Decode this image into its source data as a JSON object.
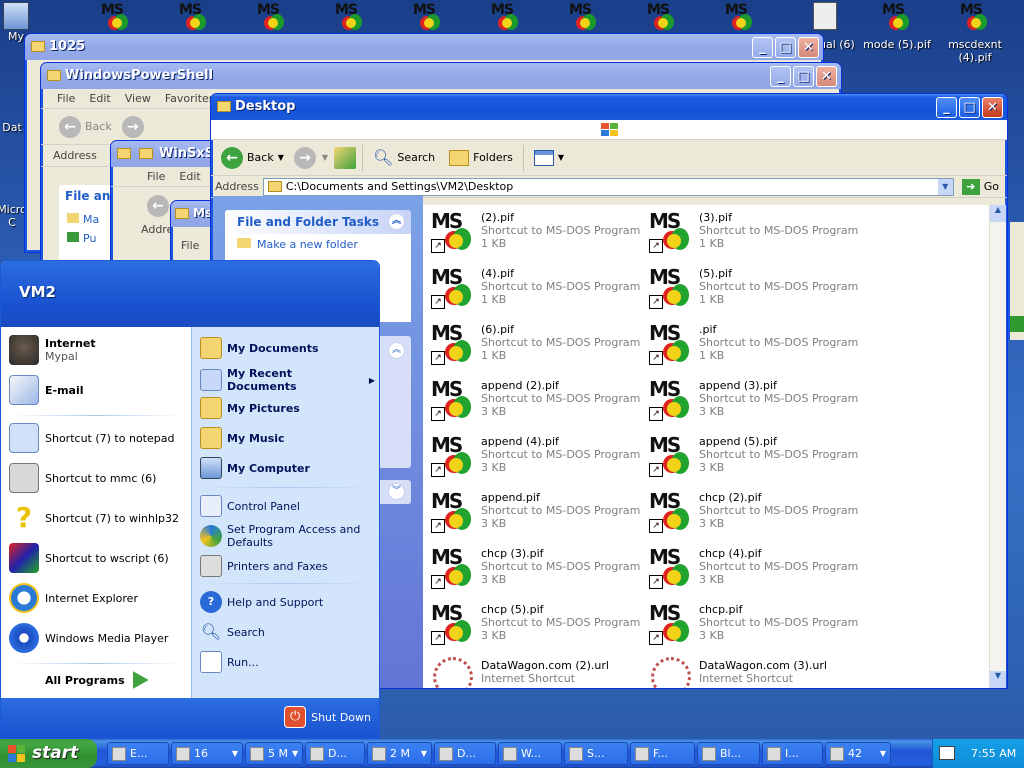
{
  "desktop": {
    "icons": [
      {
        "label": "My"
      },
      {
        "label": "Dat"
      },
      {
        "label": "Micro C"
      },
      {
        "label": "t Visual (6)"
      },
      {
        "label": "mode (5).pif"
      },
      {
        "label": "mscdexnt (4).pif"
      }
    ]
  },
  "windows": {
    "w1025": {
      "title": "1025"
    },
    "wps": {
      "title": "WindowsPowerShell",
      "menu": [
        "File",
        "Edit",
        "View",
        "Favorites"
      ],
      "back": "Back",
      "address_label": "Address",
      "task_head": "File an",
      "task_items": [
        "Ma",
        "Pu"
      ]
    },
    "winsxs": {
      "title": "WinSxS",
      "menu": [
        "File",
        "Edit"
      ],
      "address_label": "Addre",
      "sub": "Fi",
      "sub2": "Ad"
    },
    "ms": {
      "title": "Ms",
      "menu": [
        "File"
      ]
    }
  },
  "explorer": {
    "title": "Desktop",
    "toolbar": {
      "back": "Back",
      "search": "Search",
      "folders": "Folders"
    },
    "address_label": "Address",
    "address_value": "C:\\Documents and Settings\\VM2\\Desktop",
    "go": "Go",
    "task_head": "File and Folder Tasks",
    "task_item": "Make a new folder",
    "files": [
      {
        "name": " (2).pif",
        "type": "Shortcut to MS-DOS Program",
        "size": "1 KB"
      },
      {
        "name": " (3).pif",
        "type": "Shortcut to MS-DOS Program",
        "size": "1 KB"
      },
      {
        "name": " (4).pif",
        "type": "Shortcut to MS-DOS Program",
        "size": "1 KB"
      },
      {
        "name": " (5).pif",
        "type": "Shortcut to MS-DOS Program",
        "size": "1 KB"
      },
      {
        "name": " (6).pif",
        "type": "Shortcut to MS-DOS Program",
        "size": "1 KB"
      },
      {
        "name": ".pif",
        "type": "Shortcut to MS-DOS Program",
        "size": "1 KB"
      },
      {
        "name": "append (2).pif",
        "type": "Shortcut to MS-DOS Program",
        "size": "3 KB"
      },
      {
        "name": "append (3).pif",
        "type": "Shortcut to MS-DOS Program",
        "size": "3 KB"
      },
      {
        "name": "append (4).pif",
        "type": "Shortcut to MS-DOS Program",
        "size": "3 KB"
      },
      {
        "name": "append (5).pif",
        "type": "Shortcut to MS-DOS Program",
        "size": "3 KB"
      },
      {
        "name": "append.pif",
        "type": "Shortcut to MS-DOS Program",
        "size": "3 KB"
      },
      {
        "name": "chcp (2).pif",
        "type": "Shortcut to MS-DOS Program",
        "size": "3 KB"
      },
      {
        "name": "chcp (3).pif",
        "type": "Shortcut to MS-DOS Program",
        "size": "3 KB"
      },
      {
        "name": "chcp (4).pif",
        "type": "Shortcut to MS-DOS Program",
        "size": "3 KB"
      },
      {
        "name": "chcp (5).pif",
        "type": "Shortcut to MS-DOS Program",
        "size": "3 KB"
      },
      {
        "name": "chcp.pif",
        "type": "Shortcut to MS-DOS Program",
        "size": "3 KB"
      },
      {
        "name": "DataWagon.com (2).url",
        "type": "Internet Shortcut",
        "size": ""
      },
      {
        "name": "DataWagon.com (3).url",
        "type": "Internet Shortcut",
        "size": ""
      }
    ]
  },
  "startmenu": {
    "user": "VM2",
    "pinned": [
      {
        "label": "Internet",
        "sub": "Mypal",
        "icon": "raccoon-icon"
      },
      {
        "label": "E-mail",
        "sub": "",
        "icon": "email-icon"
      }
    ],
    "recent": [
      {
        "label": "Shortcut (7) to notepad",
        "icon": "notepad-icon"
      },
      {
        "label": "Shortcut to mmc (6)",
        "icon": "mmc-icon"
      },
      {
        "label": "Shortcut (7) to winhlp32",
        "icon": "help-question-icon"
      },
      {
        "label": "Shortcut to wscript (6)",
        "icon": "wscript-icon"
      },
      {
        "label": "Internet Explorer",
        "icon": "internet-explorer-icon"
      },
      {
        "label": "Windows Media Player",
        "icon": "media-player-icon"
      }
    ],
    "all_programs": "All Programs",
    "right_bold": [
      "My Documents",
      "My Recent Documents",
      "My Pictures",
      "My Music",
      "My Computer"
    ],
    "right_plain": [
      "Control Panel",
      "Set Program Access and Defaults",
      "Printers and Faxes"
    ],
    "right_bottom": [
      "Help and Support",
      "Search",
      "Run..."
    ],
    "shutdown": "Shut Down"
  },
  "taskbar": {
    "start": "start",
    "buttons": [
      {
        "label": "E..."
      },
      {
        "label": "16"
      },
      {
        "label": "5 M"
      },
      {
        "label": "D..."
      },
      {
        "label": "2 M"
      },
      {
        "label": "D..."
      },
      {
        "label": "W..."
      },
      {
        "label": "S..."
      },
      {
        "label": "F..."
      },
      {
        "label": "Bl..."
      },
      {
        "label": "I..."
      },
      {
        "label": "42"
      }
    ],
    "clock": "7:55 AM"
  }
}
